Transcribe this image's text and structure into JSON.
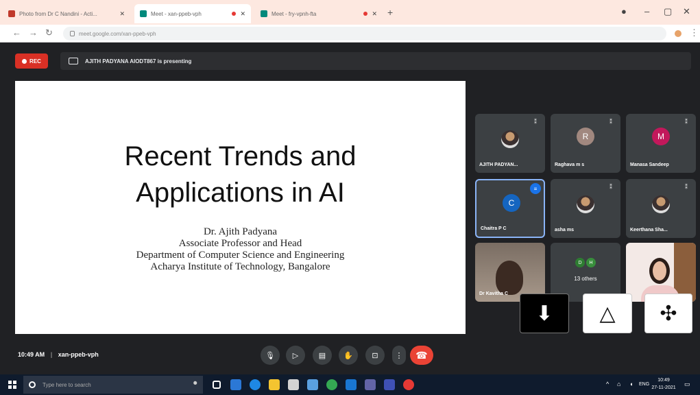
{
  "browser": {
    "tabs": [
      {
        "title": "Photo from Dr C Nandini - Acti...",
        "favicon_color": "#c0392b"
      },
      {
        "title": "Meet - xan-ppeb-vph",
        "favicon_color": "#00897b"
      },
      {
        "title": "Meet - fry-vpnh-fta",
        "favicon_color": "#00897b"
      }
    ],
    "new_tab": "+",
    "address": "meet.google.com/xan-ppeb-vph",
    "window_controls": {
      "minimize": "–",
      "maximize": "▢",
      "close": "✕"
    }
  },
  "meet": {
    "rec_label": "REC",
    "presenting_text": "AJITH PADYANA AIODT867 is presenting",
    "slide": {
      "title_line1": "Recent Trends and",
      "title_line2": "Applications in AI",
      "author": "Dr. Ajith Padyana",
      "role": "Associate Professor and Head",
      "department": "Department of Computer Science and  Engineering",
      "institute": "Acharya Institute of Technology, Bangalore"
    },
    "participants": [
      {
        "name": "AJITH PADYAN...",
        "kind": "photo"
      },
      {
        "name": "Raghava m s",
        "initial": "R",
        "color": "#a1887f"
      },
      {
        "name": "Manasa Sandeep",
        "initial": "M",
        "color": "#c2185b"
      },
      {
        "name": "Chaitra P C",
        "initial": "C",
        "color": "#1565c0",
        "speaking": true
      },
      {
        "name": "asha ms",
        "kind": "photo"
      },
      {
        "name": "Keerthana Sha...",
        "kind": "photo"
      },
      {
        "name": "Dr Kavitha C",
        "kind": "camera"
      },
      {
        "name": "13 others",
        "kind": "others",
        "initials": [
          "D",
          "H"
        ]
      },
      {
        "name": "",
        "kind": "camera2"
      }
    ],
    "time": "10:49 AM",
    "meeting_code": "xan-ppeb-vph",
    "controls": [
      "mic-icon",
      "camera-icon",
      "captions-icon",
      "raise-hand-icon",
      "present-icon",
      "more-icon"
    ],
    "end_call_icon": "phone-hangup-icon"
  },
  "taskbar": {
    "search_placeholder": "Type here to search",
    "clock_time": "10:49",
    "clock_date": "27-11-2021",
    "tray_lang": "ENG"
  }
}
